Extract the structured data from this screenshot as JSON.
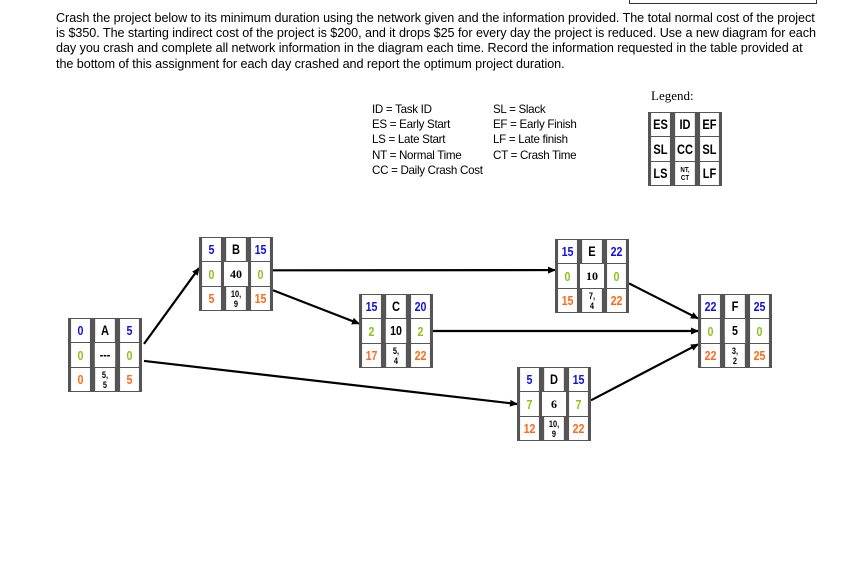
{
  "instructions": "Crash the project below to its minimum duration using the network given and the information provided. The total normal cost of the project is $350. The starting indirect cost of the project is $200, and it drops $25 for every day the project is reduced. Use a new diagram for each day you crash and complete all network information in the diagram each time. Record the information requested in the table provided at the bottom of this assignment for each day crashed and report the optimum project duration.",
  "abbreviations": {
    "left": [
      "ID = Task ID",
      "ES = Early Start",
      "LS = Late Start",
      "NT = Normal Time",
      "CC = Daily Crash Cost"
    ],
    "right": [
      "SL = Slack",
      "EF = Early Finish",
      "LF = Late finish",
      "CT = Crash Time"
    ]
  },
  "legend": {
    "title": "Legend:",
    "cells": {
      "es": "ES",
      "id": "ID",
      "ef": "EF",
      "sl_left": "SL",
      "cc": "CC",
      "sl_right": "SL",
      "ls": "LS",
      "nt_ct_1": "NT,",
      "nt_ct_2": "CT",
      "lf": "LF"
    }
  },
  "colors": {
    "early": "#1010e0",
    "slack": "#8cc21a",
    "late": "#ff6a1a"
  },
  "nodes": {
    "A": {
      "id": "A",
      "es": "0",
      "ef": "5",
      "sl": "0",
      "cc": "---",
      "ls": "0",
      "lf": "5",
      "nt": "5,",
      "ct": "5"
    },
    "B": {
      "id": "B",
      "es": "5",
      "ef": "15",
      "sl": "0",
      "cc": "40",
      "ls": "5",
      "lf": "15",
      "nt": "10,",
      "ct": "9"
    },
    "C": {
      "id": "C",
      "es": "15",
      "ef": "20",
      "sl": "2",
      "cc": "10",
      "ls": "17",
      "lf": "22",
      "nt": "5,",
      "ct": "4"
    },
    "D": {
      "id": "D",
      "es": "5",
      "ef": "15",
      "sl": "7",
      "cc": "6",
      "ls": "12",
      "lf": "22",
      "nt": "10,",
      "ct": "9"
    },
    "E": {
      "id": "E",
      "es": "15",
      "ef": "22",
      "sl": "0",
      "cc": "10",
      "ls": "15",
      "lf": "22",
      "nt": "7,",
      "ct": "4"
    },
    "F": {
      "id": "F",
      "es": "22",
      "ef": "25",
      "sl": "0",
      "cc": "5",
      "ls": "22",
      "lf": "25",
      "nt": "3,",
      "ct": "2"
    }
  },
  "edges": [
    {
      "from": "A",
      "to": "B"
    },
    {
      "from": "A",
      "to": "D"
    },
    {
      "from": "B",
      "to": "E"
    },
    {
      "from": "B",
      "to": "C"
    },
    {
      "from": "C",
      "to": "F"
    },
    {
      "from": "E",
      "to": "F"
    },
    {
      "from": "D",
      "to": "F"
    }
  ]
}
